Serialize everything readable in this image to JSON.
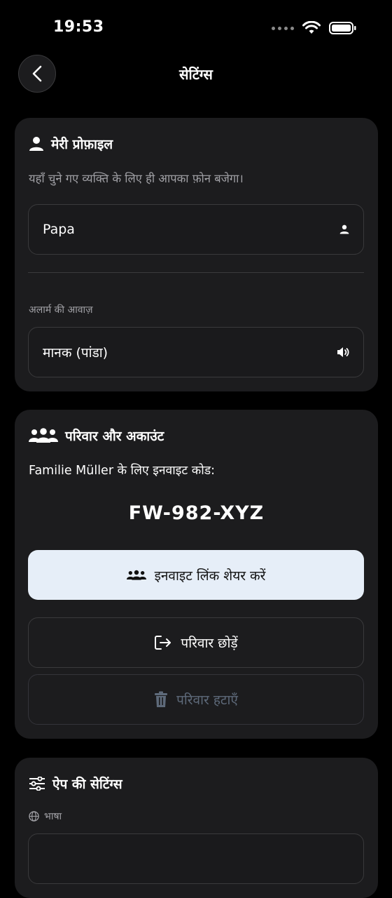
{
  "status": {
    "time": "19:53"
  },
  "nav": {
    "title": "सेटिंग्स"
  },
  "profile": {
    "title": "मेरी प्रोफ़ाइल",
    "description": "यहाँ चुने गए व्यक्ति के लिए ही आपका फ़ोन बजेगा।",
    "name_value": "Papa",
    "alarm_label": "अलार्म की आवाज़",
    "alarm_value": "मानक (पांडा)"
  },
  "family": {
    "title": "परिवार और अकाउंट",
    "invite_text": "Familie Müller के लिए इनवाइट कोड:",
    "invite_code": "FW-982-XYZ",
    "share_label": "इनवाइट लिंक शेयर करें",
    "leave_label": "परिवार छोड़ें",
    "delete_label": "परिवार हटाएँ"
  },
  "app_settings": {
    "title": "ऐप की सेटिंग्स",
    "language_label": "भाषा"
  }
}
